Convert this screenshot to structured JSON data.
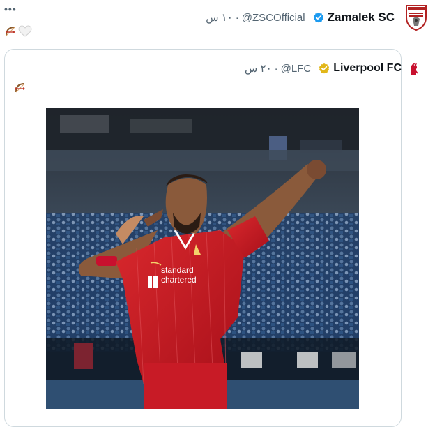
{
  "tweet": {
    "more_label": "•••",
    "author": {
      "name": "Zamalek SC",
      "handle": "@ZSCOfficial",
      "time": "١٠ س",
      "verified_icon": "blue-verified-icon",
      "avatar_icon": "zamalek-crest-icon"
    },
    "reactions": [
      {
        "icon": "bow-and-arrow-icon"
      },
      {
        "icon": "white-heart-icon"
      }
    ],
    "quoted": {
      "author": {
        "name": "Liverpool FC",
        "handle": "@LFC",
        "time": "٢٠ س",
        "verified_icon": "gold-verified-icon",
        "avatar_icon": "liverbird-icon"
      },
      "text_icon": "bow-and-arrow-icon",
      "photo": {
        "sponsor_text": "standard chartered",
        "description_icon": "player-celebration-photo"
      }
    }
  },
  "colors": {
    "text": "#0f1419",
    "secondary": "#536471",
    "verified_blue": "#1d9bf0",
    "verified_gold": "#e2b719",
    "border": "#cfd9de",
    "liverpool_red": "#c8102e"
  }
}
